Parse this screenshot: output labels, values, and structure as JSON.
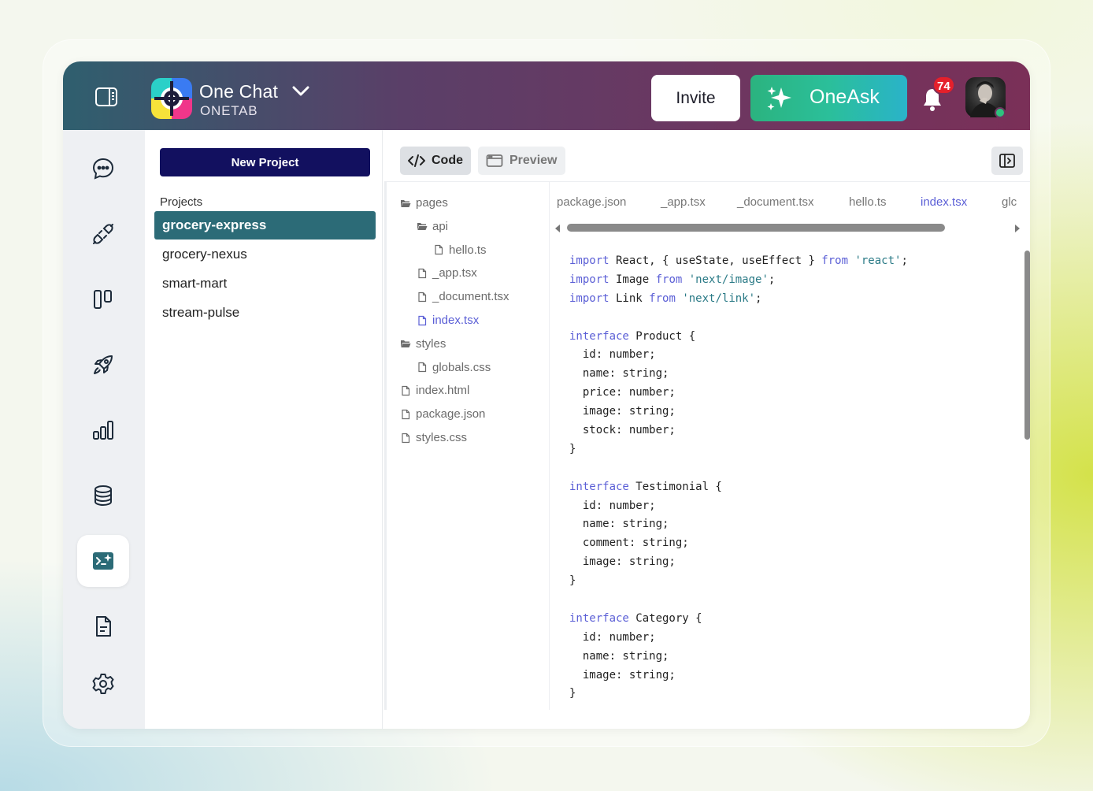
{
  "header": {
    "brand_name": "One Chat",
    "brand_sub": "ONETAB",
    "invite_label": "Invite",
    "oneask_label": "OneAsk",
    "notification_count": "74"
  },
  "rail": {
    "items": [
      "chat",
      "integrations",
      "boards",
      "launch",
      "analytics",
      "database",
      "code-ai",
      "documents",
      "settings"
    ],
    "active": "code-ai"
  },
  "projects": {
    "new_project_label": "New Project",
    "section_label": "Projects",
    "items": [
      "grocery-express",
      "grocery-nexus",
      "smart-mart",
      "stream-pulse"
    ],
    "active": "grocery-express"
  },
  "toolbar": {
    "code_label": "Code",
    "preview_label": "Preview"
  },
  "file_tree": [
    {
      "name": "pages",
      "type": "folder",
      "depth": 0
    },
    {
      "name": "api",
      "type": "folder",
      "depth": 1
    },
    {
      "name": "hello.ts",
      "type": "file",
      "depth": 2
    },
    {
      "name": "_app.tsx",
      "type": "file",
      "depth": 1
    },
    {
      "name": "_document.tsx",
      "type": "file",
      "depth": 1
    },
    {
      "name": "index.tsx",
      "type": "file",
      "depth": 1,
      "active": true
    },
    {
      "name": "styles",
      "type": "folder",
      "depth": 0
    },
    {
      "name": "globals.css",
      "type": "file",
      "depth": 1
    },
    {
      "name": "index.html",
      "type": "file",
      "depth": 0
    },
    {
      "name": "package.json",
      "type": "file",
      "depth": 0
    },
    {
      "name": "styles.css",
      "type": "file",
      "depth": 0
    }
  ],
  "file_tabs": [
    "package.json",
    "_app.tsx",
    "_document.tsx",
    "hello.ts",
    "index.tsx",
    "glc"
  ],
  "active_file_tab": "index.tsx",
  "code_lines": [
    "import React, { useState, useEffect } from 'react';",
    "import Image from 'next/image';",
    "import Link from 'next/link';",
    "",
    "interface Product {",
    "  id: number;",
    "  name: string;",
    "  price: number;",
    "  image: string;",
    "  stock: number;",
    "}",
    "",
    "interface Testimonial {",
    "  id: number;",
    "  name: string;",
    "  comment: string;",
    "  image: string;",
    "}",
    "",
    "interface Category {",
    "  id: number;",
    "  name: string;",
    "  image: string;",
    "}"
  ],
  "colors": {
    "accent": "#12105f",
    "active_project": "#2c6b77",
    "link": "#5b5fd6",
    "badge": "#e5202b"
  }
}
